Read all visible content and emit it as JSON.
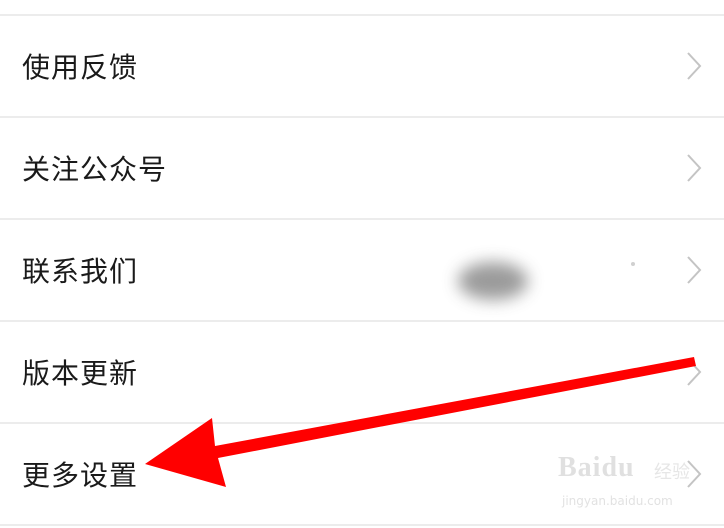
{
  "menu": {
    "items": [
      {
        "label": "使用反馈",
        "chevron_icon": "chevron-right-icon"
      },
      {
        "label": "关注公众号",
        "chevron_icon": "chevron-right-icon"
      },
      {
        "label": "联系我们",
        "chevron_icon": "chevron-right-icon"
      },
      {
        "label": "版本更新",
        "chevron_icon": "chevron-right-icon"
      },
      {
        "label": "更多设置",
        "chevron_icon": "chevron-right-icon"
      }
    ]
  },
  "annotation": {
    "arrow_color": "#ff0000",
    "points_to": "更多设置"
  },
  "watermark": {
    "brand": "Baidu",
    "suffix": "经验",
    "url": "jingyan.baidu.com"
  },
  "colors": {
    "text": "#1a1a1a",
    "divider": "#ececec",
    "chevron": "#c4c4c4",
    "background": "#ffffff"
  }
}
